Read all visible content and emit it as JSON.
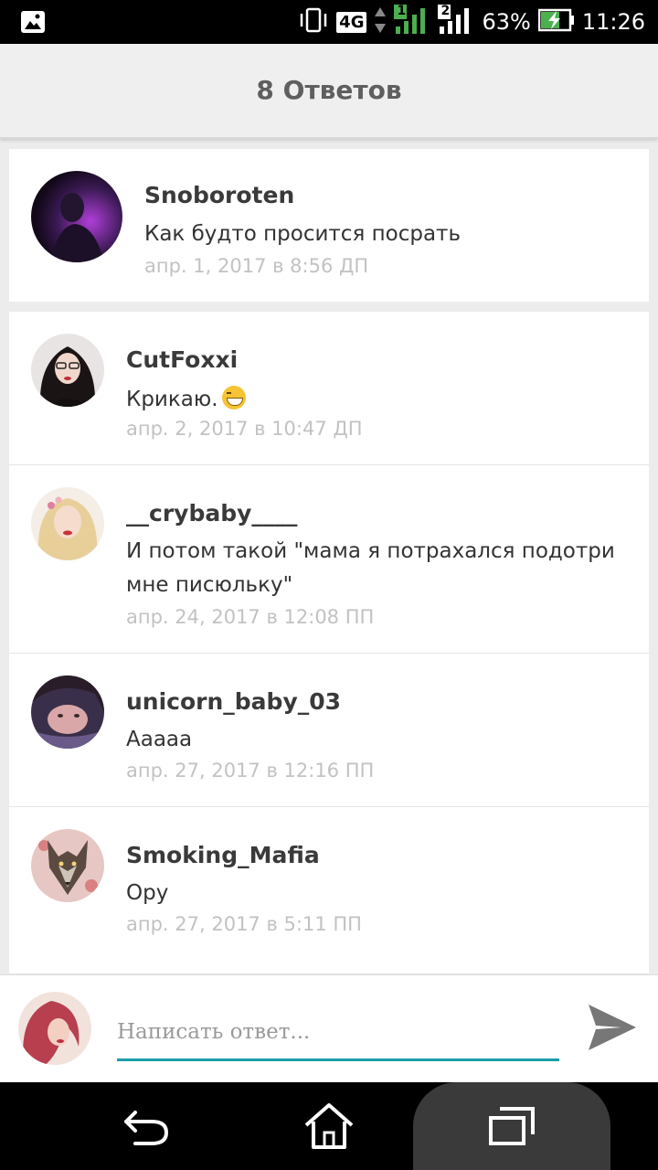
{
  "status_bar": {
    "battery": "63%",
    "time": "11:26",
    "network": "4G",
    "sim1": "1",
    "sim2": "2"
  },
  "header": {
    "title": "8 Ответов"
  },
  "post": {
    "author": "Snoboroten",
    "text": "Как будто просится посрать",
    "time": "апр. 1, 2017 в 8:56 ДП"
  },
  "replies": [
    {
      "author": "CutFoxxi",
      "text": "Крикаю.",
      "has_emoji": true,
      "time": "апр. 2, 2017 в 10:47 ДП"
    },
    {
      "author": "__crybaby____",
      "text": "И потом такой \"мама я потрахался подотри мне писюльку\"",
      "time": "апр. 24, 2017 в 12:08 ПП"
    },
    {
      "author": "unicorn_baby_03",
      "text": "Ааааа",
      "time": "апр. 27, 2017 в 12:16 ПП"
    },
    {
      "author": "Smoking_Mafia",
      "text": "Ору",
      "time": "апр. 27, 2017 в 5:11 ПП"
    }
  ],
  "composer": {
    "placeholder": "Написать ответ..."
  },
  "colors": {
    "accent": "#1a9fa8",
    "send_icon": "#777777"
  },
  "icons": {
    "status": [
      "image-icon",
      "vibrate-icon",
      "signal-icon",
      "battery-charging-icon"
    ],
    "nav": [
      "back-icon",
      "home-icon",
      "recent-apps-icon"
    ],
    "send": "send-icon"
  }
}
